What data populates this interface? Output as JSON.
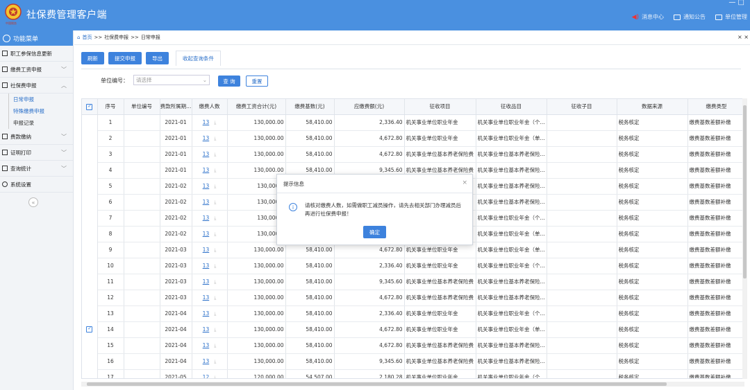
{
  "app": {
    "title": "社保费管理客户端",
    "window_controls": "— □",
    "logo_text": "中国税务",
    "links": [
      {
        "label": "消息中心",
        "icon": "speaker-icon"
      },
      {
        "label": "通知公告",
        "icon": "mail-icon"
      },
      {
        "label": "单位管理",
        "icon": "building-icon"
      }
    ]
  },
  "sidebar": {
    "header": "功能菜单",
    "items": [
      {
        "label": "职工参保信息更新",
        "expandable": false
      },
      {
        "label": "缴费工资申报",
        "expandable": true,
        "arrow": "﹀"
      },
      {
        "label": "社保费申报",
        "expandable": true,
        "arrow": "︿"
      }
    ],
    "subitems": [
      {
        "label": "日常申报",
        "active": true
      },
      {
        "label": "特殊缴费申报",
        "active": true
      },
      {
        "label": "申报记录",
        "active": false
      }
    ],
    "items2": [
      {
        "label": "费款缴纳",
        "arrow": "﹀"
      },
      {
        "label": "证明打印",
        "arrow": "﹀"
      },
      {
        "label": "查询统计",
        "arrow": "﹀"
      },
      {
        "label": "系统设置",
        "arrow": ""
      }
    ],
    "collapse": "«"
  },
  "breadcrumb": {
    "home": "首页",
    "sep1": ">>",
    "level1": "社保费申报",
    "sep2": ">>",
    "level2": "日常申报",
    "close": "× ×"
  },
  "toolbar": {
    "refresh": "刷新",
    "submit": "提交申报",
    "export": "导出",
    "collapse_filter": "收起查询条件"
  },
  "filter": {
    "label": "单位编号：",
    "placeholder": "请选择",
    "query": "查 询",
    "reset": "重置"
  },
  "table": {
    "columns": [
      "",
      "序号",
      "单位编号",
      "费款所属期...",
      "缴费人数",
      "缴费工资合计(元)",
      "缴费基数(元)",
      "应缴费额(元)",
      "征收项目",
      "征收品目",
      "征收子目",
      "数据来源",
      "缴费类型"
    ],
    "rows": [
      [
        "1",
        "",
        "2021-01",
        "13",
        "130,000.00",
        "58,410.00",
        "2,336.40",
        "机关事业单位职业年金",
        "机关事业单位职业年金（个...",
        "",
        "税务核定",
        "缴费基数差额补缴"
      ],
      [
        "2",
        "",
        "2021-01",
        "13",
        "130,000.00",
        "58,410.00",
        "4,672.80",
        "机关事业单位职业年金",
        "机关事业单位职业年金（单...",
        "",
        "税务核定",
        "缴费基数差额补缴"
      ],
      [
        "3",
        "",
        "2021-01",
        "13",
        "130,000.00",
        "58,410.00",
        "4,672.80",
        "机关事业单位基本养老保险费",
        "机关事业单位基本养老保险...",
        "",
        "税务核定",
        "缴费基数差额补缴"
      ],
      [
        "4",
        "",
        "2021-01",
        "13",
        "130,000.00",
        "58,410.00",
        "9,345.60",
        "机关事业单位基本养老保险费",
        "机关事业单位基本养老保险...",
        "",
        "税务核定",
        "缴费基数差额补缴"
      ],
      [
        "5",
        "",
        "2021-02",
        "13",
        "130,000.0",
        "",
        "",
        "",
        "机关事业单位基本养老保险...",
        "",
        "税务核定",
        "缴费基数差额补缴"
      ],
      [
        "6",
        "",
        "2021-02",
        "13",
        "130,000.0",
        "",
        "",
        "",
        "机关事业单位基本养老保险...",
        "",
        "税务核定",
        "缴费基数差额补缴"
      ],
      [
        "7",
        "",
        "2021-02",
        "13",
        "130,000.0",
        "",
        "",
        "",
        "机关事业单位职业年金（个...",
        "",
        "税务核定",
        "缴费基数差额补缴"
      ],
      [
        "8",
        "",
        "2021-02",
        "13",
        "130,000.0",
        "",
        "",
        "",
        "机关事业单位职业年金（单...",
        "",
        "税务核定",
        "缴费基数差额补缴"
      ],
      [
        "9",
        "",
        "2021-03",
        "13",
        "130,000.00",
        "58,410.00",
        "4,672.80",
        "机关事业单位职业年金",
        "机关事业单位职业年金（单...",
        "",
        "税务核定",
        "缴费基数差额补缴"
      ],
      [
        "10",
        "",
        "2021-03",
        "13",
        "130,000.00",
        "58,410.00",
        "2,336.40",
        "机关事业单位职业年金",
        "机关事业单位职业年金（个...",
        "",
        "税务核定",
        "缴费基数差额补缴"
      ],
      [
        "11",
        "",
        "2021-03",
        "13",
        "130,000.00",
        "58,410.00",
        "9,345.60",
        "机关事业单位基本养老保险费",
        "机关事业单位基本养老保险...",
        "",
        "税务核定",
        "缴费基数差额补缴"
      ],
      [
        "12",
        "",
        "2021-03",
        "13",
        "130,000.00",
        "58,410.00",
        "4,672.80",
        "机关事业单位基本养老保险费",
        "机关事业单位基本养老保险...",
        "",
        "税务核定",
        "缴费基数差额补缴"
      ],
      [
        "13",
        "",
        "2021-04",
        "13",
        "130,000.00",
        "58,410.00",
        "2,336.40",
        "机关事业单位职业年金",
        "机关事业单位职业年金（个...",
        "",
        "税务核定",
        "缴费基数差额补缴"
      ],
      [
        "14",
        "",
        "2021-04",
        "13",
        "130,000.00",
        "58,410.00",
        "4,672.80",
        "机关事业单位职业年金",
        "机关事业单位职业年金（单...",
        "",
        "税务核定",
        "缴费基数差额补缴"
      ],
      [
        "15",
        "",
        "2021-04",
        "13",
        "130,000.00",
        "58,410.00",
        "4,672.80",
        "机关事业单位基本养老保险费",
        "机关事业单位基本养老保险...",
        "",
        "税务核定",
        "缴费基数差额补缴"
      ],
      [
        "16",
        "",
        "2021-04",
        "13",
        "130,000.00",
        "58,410.00",
        "9,345.60",
        "机关事业单位基本养老保险费",
        "机关事业单位基本养老保险...",
        "",
        "税务核定",
        "缴费基数差额补缴"
      ],
      [
        "17",
        "",
        "2021-05",
        "12",
        "120,000.00",
        "54,507.00",
        "2,180.28",
        "机关事业单位职业年金",
        "机关事业单位职业年金（个...",
        "",
        "税务核定",
        "缴费基数差额补缴"
      ]
    ]
  },
  "dialog": {
    "title": "提示信息",
    "message": "请核对缴费人数，如需做职工减员操作，请先去相关部门办理减员后再进行社保费申报！",
    "ok": "确定",
    "close": "×",
    "icon": "i"
  },
  "colors": {
    "accent": "#3d82dd",
    "topbar": "#4a90e0"
  }
}
